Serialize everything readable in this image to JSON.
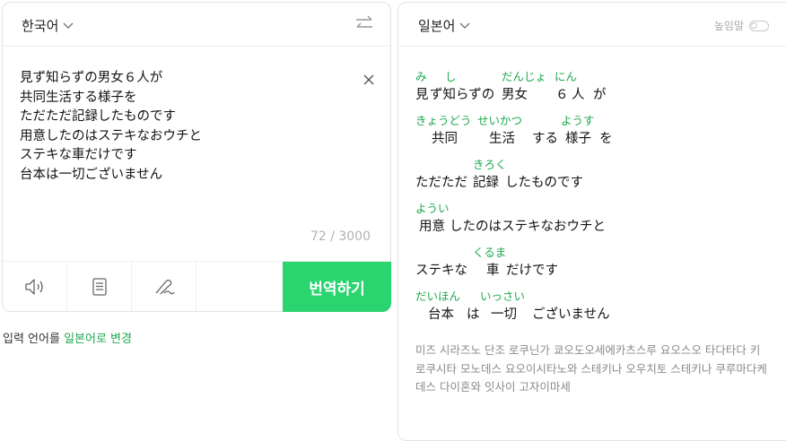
{
  "source": {
    "language": "한국어",
    "lines": [
      "見ず知らずの男女６人が",
      "共同生活する様子を",
      "ただただ記録したものです",
      "用意したのはステキなおウチと",
      "ステキな車だけです",
      "台本は一切ございません"
    ],
    "counter": "72 / 3000",
    "translate_label": "번역하기",
    "note_prefix": "입력 언어를 ",
    "note_link": "일본어로 변경"
  },
  "target": {
    "language": "일본어",
    "honorific_label": "높임말",
    "pronunciation": "미즈 시라즈노 단조 로쿠닌가 쿄오도오세에카츠스루 요오스오 타다타다 키로쿠시타 모노데스 요오이시타노와 스테키나 오우치토 스테키나 쿠루마다케데스 다이혼와 잇사이 고자이마세",
    "lines": [
      {
        "words": [
          {
            "ruby": "み",
            "base": "見"
          },
          {
            "ruby": "し",
            "base": "ず知らずの"
          },
          {
            "ruby": "だんじょ",
            "base": "男女"
          },
          {
            "ruby": "",
            "base": "６"
          },
          {
            "ruby": "にん",
            "base": "人"
          },
          {
            "ruby": "",
            "base": "が"
          }
        ]
      },
      {
        "words": [
          {
            "ruby": "きょうどう",
            "base": "共同"
          },
          {
            "ruby": "せいかつ",
            "base": "生活"
          },
          {
            "ruby": "",
            "base": "する"
          },
          {
            "ruby": "ようす",
            "base": "様子"
          },
          {
            "ruby": "",
            "base": "を"
          }
        ]
      },
      {
        "words": [
          {
            "ruby": "",
            "base": "ただただ"
          },
          {
            "ruby": "きろく",
            "base": "記録"
          },
          {
            "ruby": "",
            "base": "したものです"
          }
        ]
      },
      {
        "words": [
          {
            "ruby": "ようい",
            "base": "用意"
          },
          {
            "ruby": "",
            "base": "したのはステキなおウチと"
          }
        ]
      },
      {
        "words": [
          {
            "ruby": "",
            "base": "ステキな"
          },
          {
            "ruby": "くるま",
            "base": "車"
          },
          {
            "ruby": "",
            "base": "だけです"
          }
        ]
      },
      {
        "words": [
          {
            "ruby": "だいほん",
            "base": "台本"
          },
          {
            "ruby": "",
            "base": "は"
          },
          {
            "ruby": "いっさい",
            "base": "一切"
          },
          {
            "ruby": "",
            "base": "ございません"
          }
        ]
      }
    ]
  },
  "icons": {
    "chevron": "chevron-down-icon",
    "swap": "swap-icon",
    "clear": "close-icon",
    "speaker": "speaker-icon",
    "dictionary": "book-icon",
    "handwriting": "handwriting-icon"
  },
  "colors": {
    "accent": "#2ad46e",
    "ruby": "#1ea94f"
  }
}
